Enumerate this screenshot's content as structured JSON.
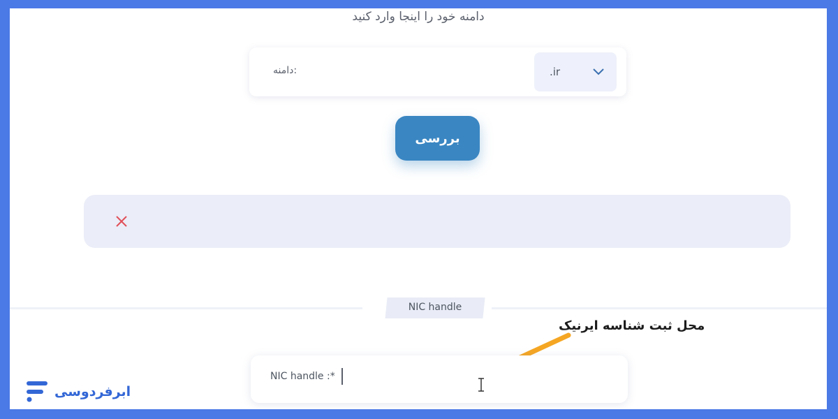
{
  "form": {
    "heading": "دامنه خود را اینجا وارد کنید",
    "domain_label": ":دامنه",
    "domain_placeholder": "",
    "tld_selected": ".ir",
    "check_button": "بررسی"
  },
  "result": {
    "status_icon": "close-icon"
  },
  "nic": {
    "section_title": "NIC handle",
    "field_label": "NIC handle :*",
    "field_value": ""
  },
  "annotation": {
    "text": "محل ثبت شناسه ایرنیک",
    "arrow_color": "#f5a623"
  },
  "brand": {
    "name": "ابرفردوسی",
    "color": "#3367d6"
  },
  "colors": {
    "frame": "#4b79e6",
    "button": "#3a86c2",
    "error": "#e0505a"
  }
}
